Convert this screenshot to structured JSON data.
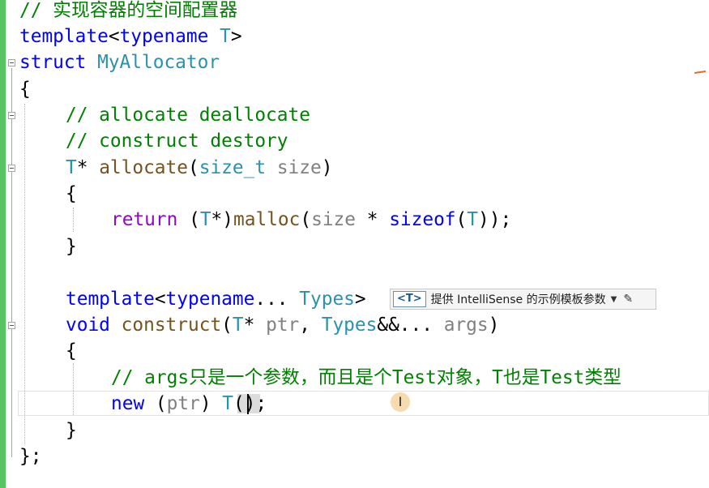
{
  "code": {
    "line1_comment": "// 实现容器的空间配置器",
    "line2": {
      "kw": "template",
      "lt": "<",
      "kw2": "typename",
      "sp": " ",
      "type": "T",
      "gt": ">"
    },
    "line3": {
      "kw": "struct",
      "sp": " ",
      "type": "MyAllocator"
    },
    "line4": "{",
    "line5_comment": "// allocate deallocate",
    "line6_comment": "// construct destory",
    "line7": {
      "type": "T",
      "star": "* ",
      "fn": "allocate",
      "open": "(",
      "type2": "size_t",
      "sp": " ",
      "param": "size",
      "close": ")"
    },
    "line8": "{",
    "line9": {
      "ctl": "return",
      "a": " (",
      "type": "T",
      "b": "*)",
      "fn": "malloc",
      "c": "(",
      "param": "size",
      "d": " * ",
      "kw": "sizeof",
      "e": "(",
      "type2": "T",
      "f": "));"
    },
    "line10": "}",
    "line12": {
      "kw": "template",
      "lt": "<",
      "kw2": "typename",
      "dots": "...",
      "sp": " ",
      "type": "Types",
      "gt": ">"
    },
    "line13": {
      "kw": "void",
      "sp": " ",
      "fn": "construct",
      "open": "(",
      "type": "T",
      "star": "* ",
      "param": "ptr",
      "comma": ", ",
      "type2": "Types",
      "amp": "&&... ",
      "param2": "args",
      "close": ")"
    },
    "line14": "{",
    "line15_comment": "// args只是一个参数，而且是个Test对象，T也是Test类型",
    "line16": {
      "kw": "new",
      "a": " (",
      "param": "ptr",
      "b": ") ",
      "type": "T",
      "c": "(",
      "d": ");"
    },
    "line17": "}",
    "line18": "};"
  },
  "template_bar": {
    "badge": "<T>",
    "label": "提供 IntelliSense 的示例模板参数",
    "dropdown_icon": "chevron-down-icon",
    "edit_icon": "pencil-icon"
  },
  "cursor": {
    "ibeam_glyph": "I"
  },
  "colors": {
    "keyword": "#0000ff",
    "type": "#2b91af",
    "function": "#74531f",
    "parameter": "#808080",
    "comment": "#008000",
    "control": "#8f08c4",
    "change_margin": "#57c464"
  }
}
